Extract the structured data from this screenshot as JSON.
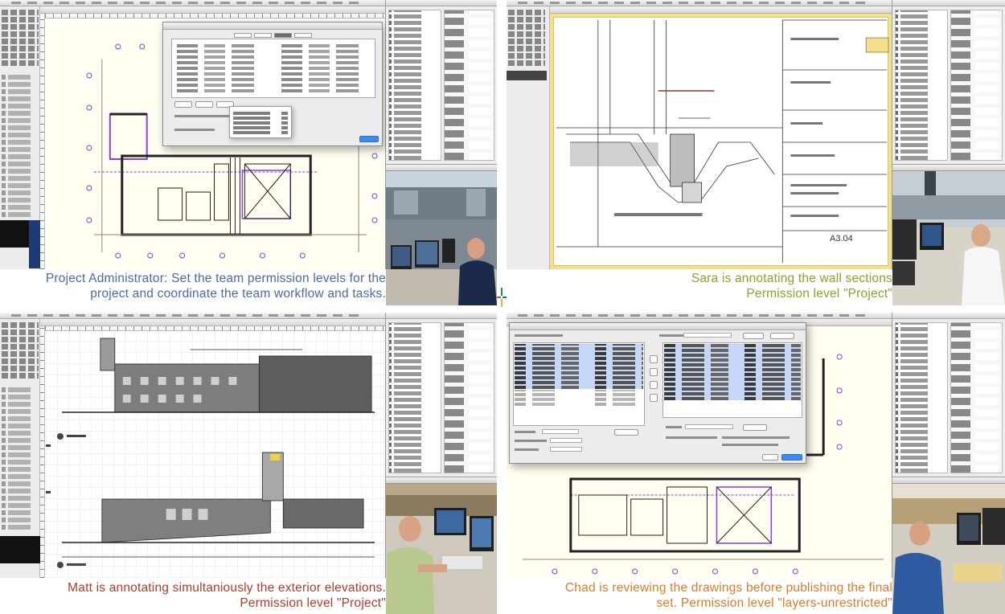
{
  "panels": [
    {
      "id": "project-administrator",
      "caption_color": "#4a6aa6",
      "caption_lines": [
        "Project Administrator:  Set the team permission levels for the",
        "project and coordinate the team workflow and tasks."
      ]
    },
    {
      "id": "sara",
      "caption_color": "#8aa428",
      "caption_lines": [
        "Sara is annotating the wall sections",
        "Permission level \"Project\""
      ],
      "sheet_number": "A3.04"
    },
    {
      "id": "matt",
      "caption_color": "#b23a2a",
      "caption_lines": [
        "Matt is annotating simultaniously the exterior elevations.",
        "Permission level \"Project\""
      ]
    },
    {
      "id": "chad",
      "caption_color": "#e07a26",
      "caption_lines": [
        "Chad  is reviewing the drawings before publishing the final",
        "set.  Permission level \"layers-unrestricted\""
      ]
    }
  ],
  "colors": {
    "plan_purple": "#8a3fd6",
    "drawing_ink": "#222222",
    "selection_blue": "#c6d6f6",
    "sheet_border_yellow": "#f5e08a",
    "crosshair": [
      "#1d8f4a",
      "#e0452b",
      "#2a66c8",
      "#f0b429"
    ]
  }
}
